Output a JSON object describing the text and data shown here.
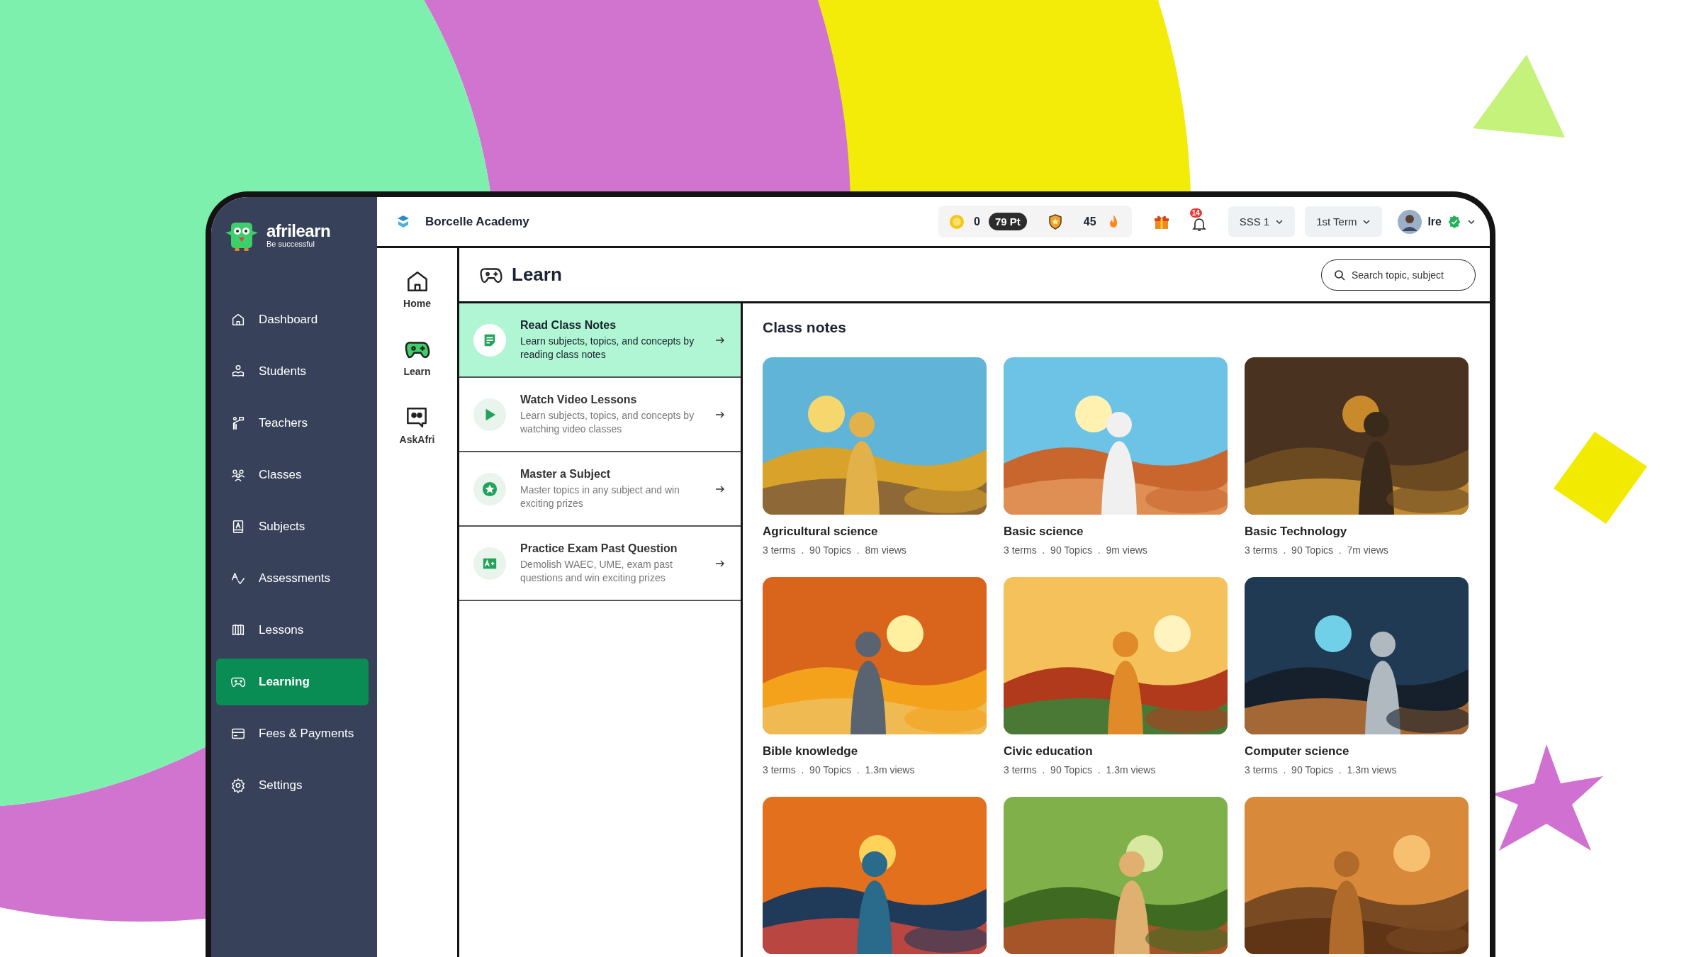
{
  "brand": {
    "name": "afrilearn",
    "tagline": "Be successful"
  },
  "sidebar": {
    "items": [
      {
        "label": "Dashboard",
        "kind": "home",
        "selected": false
      },
      {
        "label": "Students",
        "kind": "student",
        "selected": false
      },
      {
        "label": "Teachers",
        "kind": "teacher",
        "selected": false
      },
      {
        "label": "Classes",
        "kind": "group",
        "selected": false
      },
      {
        "label": "Subjects",
        "kind": "book",
        "selected": false
      },
      {
        "label": "Assessments",
        "kind": "assess",
        "selected": false
      },
      {
        "label": "Lessons",
        "kind": "lessons",
        "selected": false
      },
      {
        "label": "Learning",
        "kind": "gamepad",
        "selected": true
      },
      {
        "label": "Fees & Payments",
        "kind": "card",
        "selected": false
      },
      {
        "label": "Settings",
        "kind": "gear",
        "selected": false
      }
    ]
  },
  "topbar": {
    "school": "Borcelle Academy",
    "coins": "0",
    "points": "79 Pt",
    "streak": "45",
    "notifications": "14",
    "class_select": "SSS 1",
    "term_select": "1st Term",
    "user": "Ire"
  },
  "rail": [
    {
      "label": "Home",
      "kind": "home",
      "selected": false
    },
    {
      "label": "Learn",
      "kind": "gamepad",
      "selected": true
    },
    {
      "label": "AskAfri",
      "kind": "ask",
      "selected": false
    }
  ],
  "page": {
    "title": "Learn",
    "search": {
      "placeholder": "Search topic, subject"
    }
  },
  "menu": [
    {
      "kind": "notes",
      "title": "Read Class Notes",
      "description": "Learn subjects, topics, and concepts by reading class notes",
      "selected": true
    },
    {
      "kind": "video",
      "title": "Watch Video Lessons",
      "description": "Learn subjects, topics, and concepts by watching video classes",
      "selected": false
    },
    {
      "kind": "star",
      "title": "Master a Subject",
      "description": "Master topics in any subject and win exciting prizes",
      "selected": false
    },
    {
      "kind": "exam",
      "title": "Practice Exam Past Question",
      "description": "Demolish WAEC, UME, exam past questions and win exciting prizes",
      "selected": false
    }
  ],
  "class_notes": {
    "title": "Class notes",
    "cards": [
      {
        "kind": "course",
        "title": "Agricultural science",
        "meta": "3 terms  .  90 Topics  .  8m views"
      },
      {
        "kind": "course",
        "title": "Basic science",
        "meta": "3 terms  .  90 Topics  .  9m views"
      },
      {
        "kind": "course",
        "title": "Basic Technology",
        "meta": "3 terms  .  90 Topics  .  7m views"
      },
      {
        "kind": "course",
        "title": "Bible knowledge",
        "meta": "3 terms  .  90 Topics  .  1.3m views"
      },
      {
        "kind": "course",
        "title": "Civic education",
        "meta": "3 terms  .  90 Topics  .  1.3m views"
      },
      {
        "kind": "course",
        "title": "Computer science",
        "meta": "3 terms  .  90 Topics  .  1.3m views"
      },
      {
        "kind": "picture"
      },
      {
        "kind": "picture"
      },
      {
        "kind": "picture"
      }
    ]
  }
}
